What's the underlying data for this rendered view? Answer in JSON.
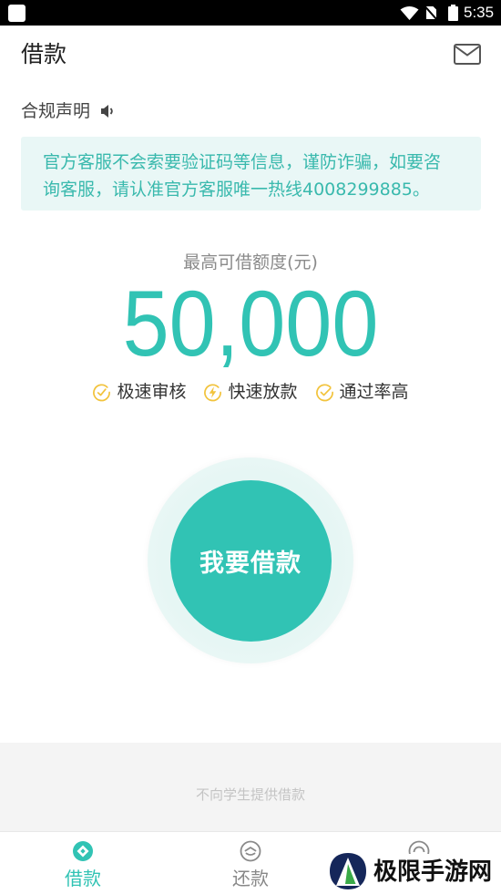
{
  "status_bar": {
    "time": "5:35",
    "icons": [
      "app-icon",
      "wifi-icon",
      "no-sim-icon",
      "battery-icon"
    ]
  },
  "header": {
    "title": "借款",
    "mail_icon": "mail-icon"
  },
  "compliance": {
    "label": "合规声明",
    "icon": "speaker-icon"
  },
  "notice": {
    "text": "官方客服不会索要验证码等信息，谨防诈骗，如要咨询客服，请认准官方客服唯一热线4008299885。"
  },
  "limit": {
    "label": "最高可借额度(元)",
    "amount": "50,000"
  },
  "features": [
    {
      "label": "极速审核",
      "icon": "clock-check-icon"
    },
    {
      "label": "快速放款",
      "icon": "lightning-icon"
    },
    {
      "label": "通过率高",
      "icon": "check-circle-icon"
    }
  ],
  "borrow_button": {
    "label": "我要借款"
  },
  "footer_note": "不向学生提供借款",
  "nav": {
    "items": [
      {
        "label": "借款",
        "icon": "borrow-icon",
        "active": true
      },
      {
        "label": "还款",
        "icon": "repay-icon",
        "active": false
      },
      {
        "icon": "circle-icon",
        "active": false
      }
    ]
  },
  "watermark": {
    "text": "极限手游网"
  },
  "colors": {
    "accent": "#31c3b4",
    "notice_bg": "#e9f7f6",
    "feature_icon": "#f2c33c"
  }
}
